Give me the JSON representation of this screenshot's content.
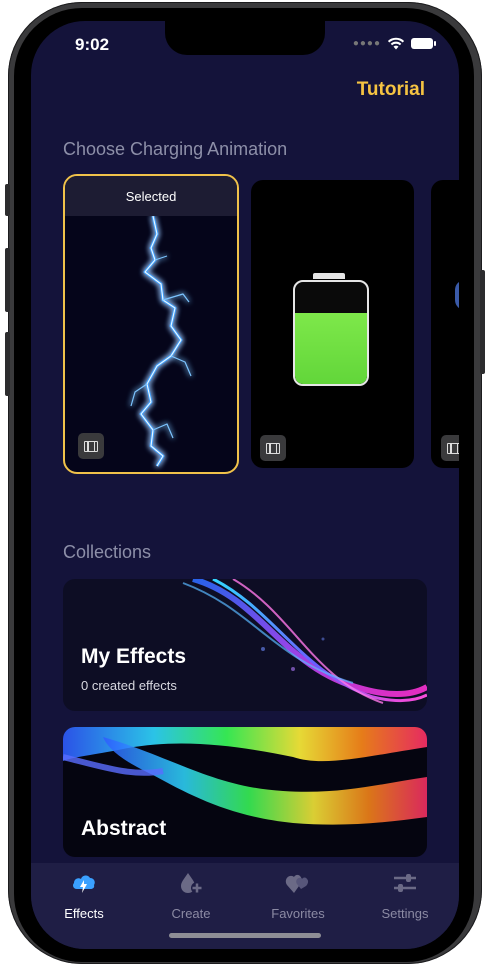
{
  "status_bar": {
    "time": "9:02"
  },
  "header": {
    "tutorial_label": "Tutorial"
  },
  "animations": {
    "section_title": "Choose Charging Animation",
    "selected_label": "Selected"
  },
  "collections": {
    "section_title": "Collections",
    "items": [
      {
        "title": "My Effects",
        "subtitle": "0 created effects"
      },
      {
        "title": "Abstract"
      }
    ]
  },
  "tab_bar": {
    "tabs": [
      {
        "label": "Effects",
        "icon": "bolt-cloud-icon",
        "active": true
      },
      {
        "label": "Create",
        "icon": "drop-plus-icon",
        "active": false
      },
      {
        "label": "Favorites",
        "icon": "hearts-icon",
        "active": false
      },
      {
        "label": "Settings",
        "icon": "sliders-icon",
        "active": false
      }
    ]
  },
  "colors": {
    "background": "#14133a",
    "accent": "#f5c342",
    "tab_bar": "#1f1e45"
  }
}
